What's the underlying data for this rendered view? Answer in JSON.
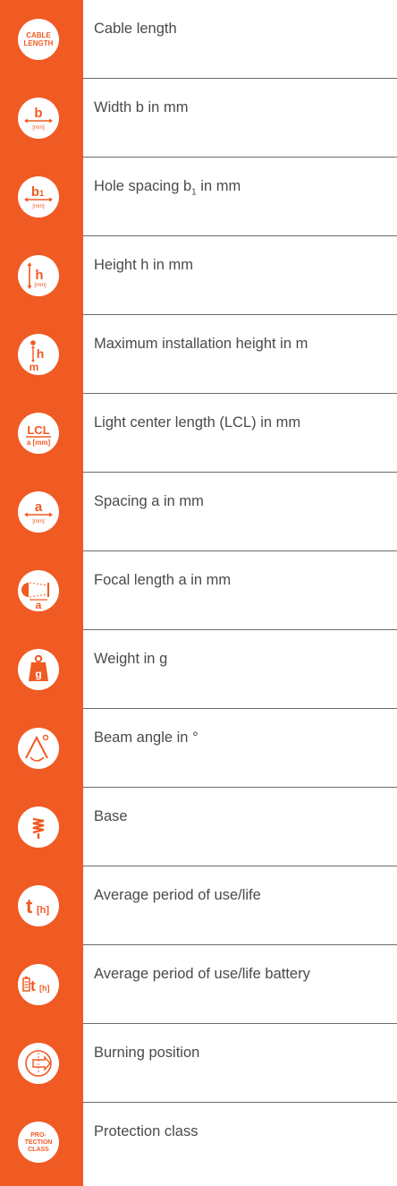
{
  "colors": {
    "accent": "#f05a23",
    "text": "#4a4a4a",
    "divider": "#6b6b6b"
  },
  "items": [
    {
      "icon": "cable-length-icon",
      "icon_text": "CABLE LENGTH",
      "label": "Cable length"
    },
    {
      "icon": "width-icon",
      "icon_text": "b [mm]",
      "label": "Width b in mm"
    },
    {
      "icon": "hole-spacing-icon",
      "icon_text": "b1 [mm]",
      "label_main": "Hole spacing b",
      "label_sub": "1",
      "label_end": " in mm"
    },
    {
      "icon": "height-icon",
      "icon_text": "h [mm]",
      "label": "Height h in mm"
    },
    {
      "icon": "installation-height-icon",
      "icon_text": "h m",
      "label": "Maximum installation height in m"
    },
    {
      "icon": "light-center-length-icon",
      "icon_text": "LCL a[mm]",
      "label": "Light center length (LCL) in mm"
    },
    {
      "icon": "spacing-icon",
      "icon_text": "a [mm]",
      "label": "Spacing a in mm"
    },
    {
      "icon": "focal-length-icon",
      "icon_text": "a",
      "label": "Focal length a in mm"
    },
    {
      "icon": "weight-icon",
      "icon_text": "g",
      "label": "Weight in g"
    },
    {
      "icon": "beam-angle-icon",
      "icon_text": "°",
      "label": "Beam angle in °"
    },
    {
      "icon": "base-icon",
      "icon_text": "",
      "label": "Base"
    },
    {
      "icon": "life-icon",
      "icon_text": "t[h]",
      "label": "Average period of use/life"
    },
    {
      "icon": "battery-life-icon",
      "icon_text": "t[h]",
      "label": "Average period of use/life battery"
    },
    {
      "icon": "burning-position-icon",
      "icon_text": "",
      "label": "Burning position"
    },
    {
      "icon": "protection-class-icon",
      "icon_text": "PRO- TECTION CLASS",
      "label": "Protection class"
    }
  ]
}
